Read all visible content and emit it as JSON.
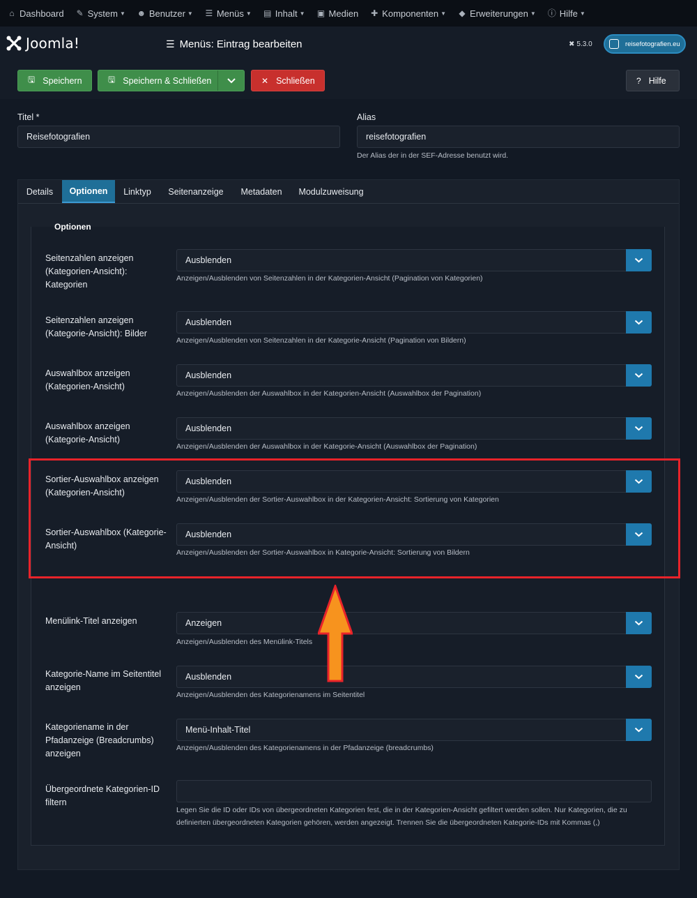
{
  "topnav": [
    {
      "label": "Dashboard",
      "icon": "home-icon",
      "caret": false
    },
    {
      "label": "System",
      "icon": "wrench-icon",
      "caret": true
    },
    {
      "label": "Benutzer",
      "icon": "users-icon",
      "caret": true
    },
    {
      "label": "Menüs",
      "icon": "list-icon",
      "caret": true
    },
    {
      "label": "Inhalt",
      "icon": "file-icon",
      "caret": true
    },
    {
      "label": "Medien",
      "icon": "image-icon",
      "caret": false
    },
    {
      "label": "Komponenten",
      "icon": "puzzle-icon",
      "caret": true
    },
    {
      "label": "Erweiterungen",
      "icon": "cubes-icon",
      "caret": true
    },
    {
      "label": "Hilfe",
      "icon": "info-icon",
      "caret": true
    }
  ],
  "header": {
    "logo_text": "Joomla!",
    "title": "Menüs: Eintrag bearbeiten",
    "version": "5.3.0",
    "site_label": "reisefotografien.eu"
  },
  "toolbar": {
    "save": "Speichern",
    "save_close": "Speichern & Schließen",
    "close": "Schließen",
    "help": "Hilfe"
  },
  "form": {
    "title_label": "Titel *",
    "title_value": "Reisefotografien",
    "alias_label": "Alias",
    "alias_value": "reisefotografien",
    "alias_hint": "Der Alias der in der SEF-Adresse benutzt wird."
  },
  "tabs": [
    "Details",
    "Optionen",
    "Linktyp",
    "Seitenanzeige",
    "Metadaten",
    "Modulzuweisung"
  ],
  "active_tab": "Optionen",
  "legend": "Optionen",
  "options": [
    {
      "label": "Seitenzahlen anzeigen (Kategorien-Ansicht): Kategorien",
      "value": "Ausblenden",
      "desc": "Anzeigen/Ausblenden von Seitenzahlen in der Kategorien-Ansicht (Pagination von Kategorien)"
    },
    {
      "label": "Seitenzahlen anzeigen (Kategorie-Ansicht): Bilder",
      "value": "Ausblenden",
      "desc": "Anzeigen/Ausblenden von Seitenzahlen in der Kategorie-Ansicht (Pagination von Bildern)"
    },
    {
      "label": "Auswahlbox anzeigen (Kategorien-Ansicht)",
      "value": "Ausblenden",
      "desc": "Anzeigen/Ausblenden der Auswahlbox in der Kategorien-Ansicht (Auswahlbox der Pagination)"
    },
    {
      "label": "Auswahlbox anzeigen (Kategorie-Ansicht)",
      "value": "Ausblenden",
      "desc": "Anzeigen/Ausblenden der Auswahlbox in der Kategorie-Ansicht (Auswahlbox der Pagination)"
    },
    {
      "label": "Sortier-Auswahlbox anzeigen (Kategorien-Ansicht)",
      "value": "Ausblenden",
      "desc": "Anzeigen/Ausblenden der Sortier-Auswahlbox in der Kategorien-Ansicht: Sortierung von Kategorien"
    },
    {
      "label": "Sortier-Auswahlbox (Kategorie-Ansicht)",
      "value": "Ausblenden",
      "desc": "Anzeigen/Ausblenden der Sortier-Auswahlbox in Kategorie-Ansicht: Sortierung von Bildern"
    },
    {
      "label": "Menülink-Titel anzeigen",
      "value": "Anzeigen",
      "desc": "Anzeigen/Ausblenden des Menülink-Titels"
    },
    {
      "label": "Kategorie-Name im Seitentitel anzeigen",
      "value": "Ausblenden",
      "desc": "Anzeigen/Ausblenden des Kategorienamens im Seitentitel"
    },
    {
      "label": "Kategoriename in der Pfadanzeige (Breadcrumbs) anzeigen",
      "value": "Menü-Inhalt-Titel",
      "desc": "Anzeigen/Ausblenden des Kategorienamens in der Pfadanzeige (breadcrumbs)"
    }
  ],
  "parent_filter": {
    "label": "Übergeordnete Kategorien-ID filtern",
    "value": "",
    "desc_line1": "Legen Sie die ID oder IDs von übergeordneten Kategorien fest, die in der Kategorien-Ansicht gefiltert werden sollen. Nur Kategorien, die zu",
    "desc_line2": "definierten übergeordneten Kategorien gehören, werden angezeigt. Trennen Sie die übergeordneten Kategorie-IDs mit Kommas (,)"
  },
  "colors": {
    "accent": "#1f79ad",
    "save": "#3f8e4a",
    "close": "#c8302d",
    "highlight": "#e8232a",
    "arrow": "#f7931e"
  }
}
